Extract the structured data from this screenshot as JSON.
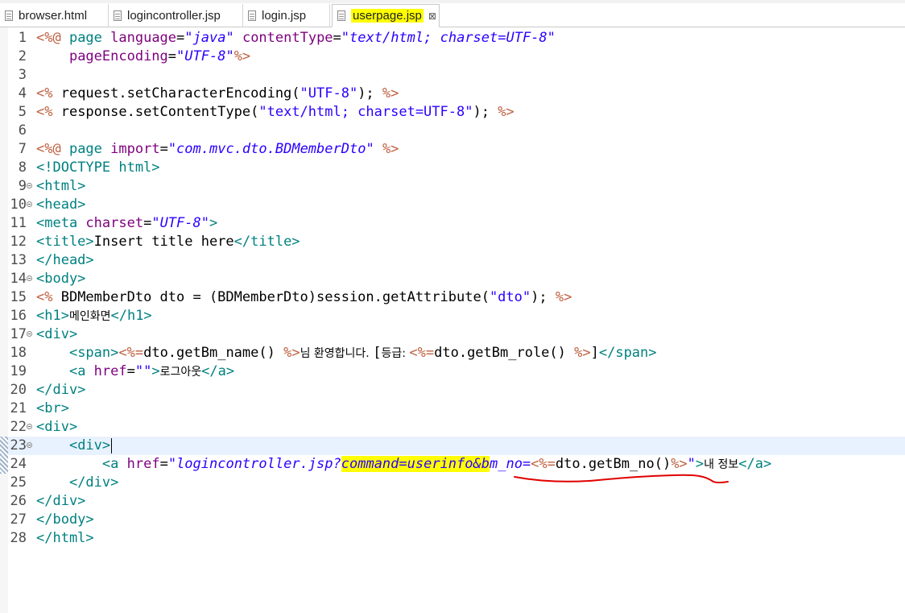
{
  "tabs": [
    {
      "label": "browser.html",
      "active": false
    },
    {
      "label": "logincontroller.jsp",
      "active": false
    },
    {
      "label": "login.jsp",
      "active": false
    },
    {
      "label": "userpage.jsp",
      "active": true
    }
  ],
  "close_glyph": "⊠",
  "colors": {
    "highlight": "#ffff00",
    "annotation": "#e00000",
    "tag": "#008080",
    "delim": "#bf5f3f",
    "attr": "#7f007f",
    "string": "#2a00ff"
  },
  "lines": [
    {
      "n": "1",
      "fold": false,
      "tokens": [
        [
          "delim",
          "<%@ "
        ],
        [
          "tag",
          "page "
        ],
        [
          "attr",
          "language"
        ],
        [
          "plain",
          "="
        ],
        [
          "str",
          "\"java\""
        ],
        [
          "plain",
          " "
        ],
        [
          "attr",
          "contentType"
        ],
        [
          "plain",
          "="
        ],
        [
          "str",
          "\"text/html; charset=UTF-8\""
        ]
      ]
    },
    {
      "n": "2",
      "fold": false,
      "tokens": [
        [
          "plain",
          "    "
        ],
        [
          "attr",
          "pageEncoding"
        ],
        [
          "plain",
          "="
        ],
        [
          "str",
          "\"UTF-8\""
        ],
        [
          "delim",
          "%>"
        ]
      ]
    },
    {
      "n": "3",
      "fold": false,
      "tokens": []
    },
    {
      "n": "4",
      "fold": false,
      "tokens": [
        [
          "delim",
          "<% "
        ],
        [
          "plain",
          "request.setCharacterEncoding("
        ],
        [
          "jstr",
          "\"UTF-8\""
        ],
        [
          "plain",
          "); "
        ],
        [
          "delim",
          "%>"
        ]
      ]
    },
    {
      "n": "5",
      "fold": false,
      "tokens": [
        [
          "delim",
          "<% "
        ],
        [
          "plain",
          "response.setContentType("
        ],
        [
          "jstr",
          "\"text/html; charset=UTF-8\""
        ],
        [
          "plain",
          "); "
        ],
        [
          "delim",
          "%>"
        ]
      ]
    },
    {
      "n": "6",
      "fold": false,
      "tokens": []
    },
    {
      "n": "7",
      "fold": false,
      "tokens": [
        [
          "delim",
          "<%@ "
        ],
        [
          "tag",
          "page "
        ],
        [
          "attr",
          "import"
        ],
        [
          "plain",
          "="
        ],
        [
          "str",
          "\"com.mvc.dto.BDMemberDto\""
        ],
        [
          "plain",
          " "
        ],
        [
          "delim",
          "%>"
        ]
      ]
    },
    {
      "n": "8",
      "fold": false,
      "tokens": [
        [
          "tag",
          "<!DOCTYPE html>"
        ]
      ]
    },
    {
      "n": "9",
      "fold": true,
      "tokens": [
        [
          "tag",
          "<html>"
        ]
      ]
    },
    {
      "n": "10",
      "fold": true,
      "tokens": [
        [
          "tag",
          "<head>"
        ]
      ]
    },
    {
      "n": "11",
      "fold": false,
      "tokens": [
        [
          "tag",
          "<meta "
        ],
        [
          "attr",
          "charset"
        ],
        [
          "plain",
          "="
        ],
        [
          "str",
          "\"UTF-8\""
        ],
        [
          "tag",
          ">"
        ]
      ]
    },
    {
      "n": "12",
      "fold": false,
      "tokens": [
        [
          "tag",
          "<title>"
        ],
        [
          "plain",
          "Insert title here"
        ],
        [
          "tag",
          "</title>"
        ]
      ]
    },
    {
      "n": "13",
      "fold": false,
      "tokens": [
        [
          "tag",
          "</head>"
        ]
      ]
    },
    {
      "n": "14",
      "fold": true,
      "tokens": [
        [
          "tag",
          "<body>"
        ]
      ]
    },
    {
      "n": "15",
      "fold": false,
      "tokens": [
        [
          "delim",
          "<% "
        ],
        [
          "plain",
          "BDMemberDto dto = (BDMemberDto)session.getAttribute("
        ],
        [
          "jstr",
          "\"dto\""
        ],
        [
          "plain",
          "); "
        ],
        [
          "delim",
          "%>"
        ]
      ]
    },
    {
      "n": "16",
      "fold": false,
      "tokens": [
        [
          "tag",
          "<h1>"
        ],
        [
          "ko",
          "메인화면"
        ],
        [
          "tag",
          "</h1>"
        ]
      ]
    },
    {
      "n": "17",
      "fold": true,
      "tokens": [
        [
          "tag",
          "<div>"
        ]
      ]
    },
    {
      "n": "18",
      "fold": false,
      "tokens": [
        [
          "plain",
          "    "
        ],
        [
          "tag",
          "<span>"
        ],
        [
          "delim",
          "<%="
        ],
        [
          "plain",
          "dto.getBm_name() "
        ],
        [
          "delim",
          "%>"
        ],
        [
          "ko",
          "님 환영합니다. "
        ],
        [
          "plain",
          "["
        ],
        [
          "ko",
          "등급: "
        ],
        [
          "delim",
          "<%="
        ],
        [
          "plain",
          "dto.getBm_role() "
        ],
        [
          "delim",
          "%>"
        ],
        [
          "plain",
          "]"
        ],
        [
          "tag",
          "</span>"
        ]
      ]
    },
    {
      "n": "19",
      "fold": false,
      "tokens": [
        [
          "plain",
          "    "
        ],
        [
          "tag",
          "<a "
        ],
        [
          "attr",
          "href"
        ],
        [
          "plain",
          "="
        ],
        [
          "str",
          "\"\""
        ],
        [
          "tag",
          ">"
        ],
        [
          "ko",
          "로그아웃"
        ],
        [
          "tag",
          "</a>"
        ]
      ]
    },
    {
      "n": "20",
      "fold": false,
      "tokens": [
        [
          "tag",
          "</div>"
        ]
      ]
    },
    {
      "n": "21",
      "fold": false,
      "tokens": [
        [
          "tag",
          "<br>"
        ]
      ]
    },
    {
      "n": "22",
      "fold": true,
      "tokens": [
        [
          "tag",
          "<div>"
        ]
      ]
    },
    {
      "n": "23",
      "fold": true,
      "current": true,
      "tokens": [
        [
          "plain",
          "    "
        ],
        [
          "tag",
          "<div>"
        ],
        [
          "caret",
          ""
        ]
      ]
    },
    {
      "n": "24",
      "fold": false,
      "tokens": [
        [
          "plain",
          "        "
        ],
        [
          "tag",
          "<a "
        ],
        [
          "attr",
          "href"
        ],
        [
          "plain",
          "="
        ],
        [
          "str",
          "\"logincontroller.jsp?"
        ],
        [
          "strhl",
          "command=userinfo&b"
        ],
        [
          "str",
          "m_no="
        ],
        [
          "delim",
          "<%="
        ],
        [
          "plain",
          "dto.getBm_no()"
        ],
        [
          "delim",
          "%>"
        ],
        [
          "str",
          "\""
        ],
        [
          "tag",
          ">"
        ],
        [
          "ko",
          "내 정보"
        ],
        [
          "tag",
          "</a>"
        ]
      ]
    },
    {
      "n": "25",
      "fold": false,
      "tokens": [
        [
          "plain",
          "    "
        ],
        [
          "tag",
          "</div>"
        ]
      ]
    },
    {
      "n": "26",
      "fold": false,
      "tokens": [
        [
          "tag",
          "</div>"
        ]
      ]
    },
    {
      "n": "27",
      "fold": false,
      "tokens": [
        [
          "tag",
          "</body>"
        ]
      ]
    },
    {
      "n": "28",
      "fold": false,
      "tokens": [
        [
          "tag",
          "</html>"
        ]
      ]
    }
  ]
}
